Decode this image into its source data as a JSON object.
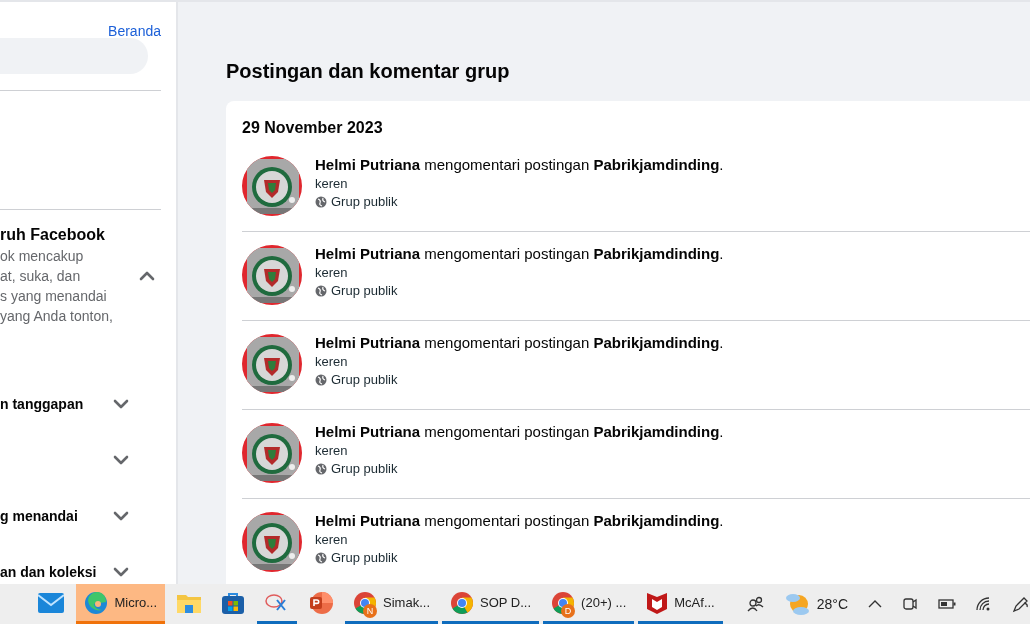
{
  "sidebar": {
    "home_link": "Beranda",
    "section": {
      "title": "ruh Facebook",
      "description": "ok mencakup\nat, suka, dan\ns yang menandai\nyang Anda tonton,",
      "expanded": true
    },
    "items": [
      {
        "label": "n tanggapan",
        "expanded": false
      },
      {
        "expanded": false
      },
      {
        "label": "g menandai",
        "expanded": false
      },
      {
        "label": "an dan koleksi",
        "expanded": false
      }
    ]
  },
  "main": {
    "title": "Postingan dan komentar grup",
    "date": "29 November 2023",
    "activities": [
      {
        "text": "**Helmi Putriana** mengomentari postingan **Pabrikjamdinding**.",
        "comment": "keren",
        "audience": "Grup publik"
      },
      {
        "text": "**Helmi Putriana** mengomentari postingan **Pabrikjamdinding**.",
        "comment": "keren",
        "audience": "Grup publik"
      },
      {
        "text": "**Helmi Putriana** mengomentari postingan **Pabrikjamdinding**.",
        "comment": "keren",
        "audience": "Grup publik"
      },
      {
        "text": "**Helmi Putriana** mengomentari postingan **Pabrikjamdinding**.",
        "comment": "keren",
        "audience": "Grup publik"
      },
      {
        "text": "**Helmi Putriana** mengomentari postingan **Pabrikjamdinding**.",
        "comment": "keren",
        "audience": "Grup publik"
      }
    ]
  },
  "taskbar": {
    "apps": [
      {
        "kind": "mail",
        "running": false,
        "selected": false
      },
      {
        "kind": "edge",
        "label": "Micro...",
        "running": true,
        "selected": true
      },
      {
        "kind": "folder",
        "running": false,
        "selected": false
      },
      {
        "kind": "store",
        "running": false,
        "selected": false
      },
      {
        "kind": "snip",
        "running": true,
        "selected": false
      },
      {
        "kind": "powerpoint",
        "running": false,
        "selected": false
      },
      {
        "kind": "chrome",
        "label": "Simak...",
        "badge": "N",
        "running": true,
        "selected": false
      },
      {
        "kind": "chrome",
        "label": "SOP D...",
        "running": true,
        "selected": false
      },
      {
        "kind": "chrome",
        "label": "(20+) ...",
        "badge": "D",
        "running": true,
        "selected": false
      },
      {
        "kind": "mcafee",
        "label": "McAf...",
        "running": true,
        "selected": false
      }
    ],
    "weather": "28°C"
  }
}
